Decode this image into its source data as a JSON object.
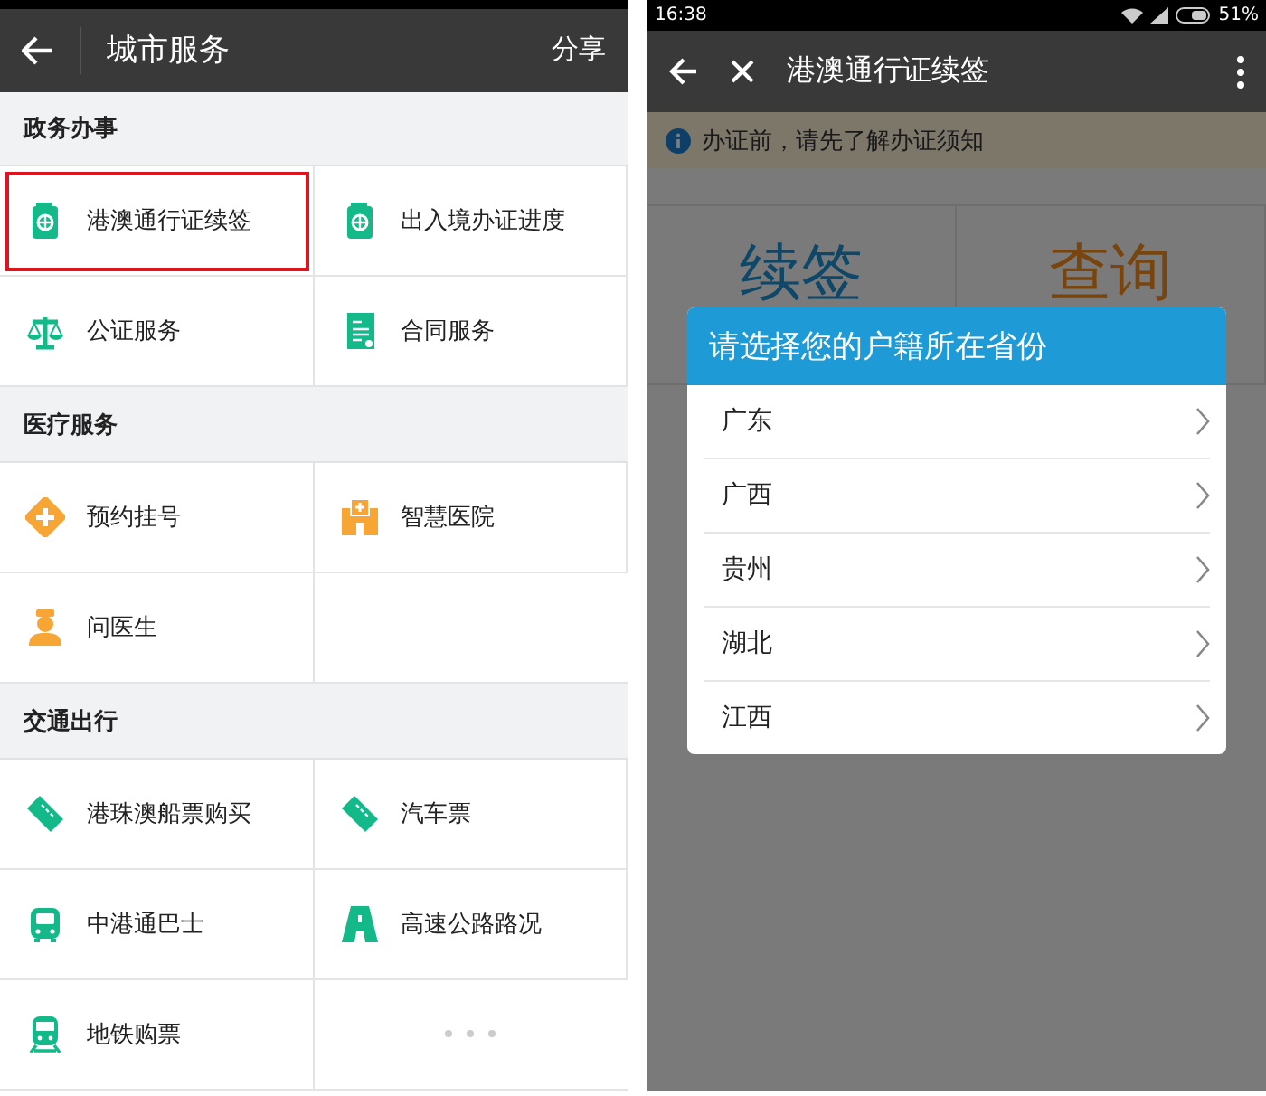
{
  "left_screen": {
    "header": {
      "title": "城市服务",
      "action": "分享"
    },
    "sections": [
      {
        "title": "政务办事",
        "items": [
          {
            "kind": "service",
            "label": "港澳通行证续签",
            "selected": true
          },
          {
            "kind": "service",
            "label": "出入境办证进度",
            "selected": false
          },
          {
            "kind": "service",
            "label": "公证服务",
            "selected": false
          },
          {
            "kind": "service",
            "label": "合同服务",
            "selected": false
          }
        ]
      },
      {
        "title": "医疗服务",
        "items": [
          {
            "kind": "service",
            "label": "预约挂号",
            "selected": false
          },
          {
            "kind": "service",
            "label": "智慧医院",
            "selected": false
          },
          {
            "kind": "service",
            "label": "问医生",
            "selected": false
          },
          {
            "kind": "empty"
          }
        ]
      },
      {
        "title": "交通出行",
        "items": [
          {
            "kind": "service",
            "label": "港珠澳船票购买",
            "selected": false
          },
          {
            "kind": "service",
            "label": "汽车票",
            "selected": false
          },
          {
            "kind": "service",
            "label": "中港通巴士",
            "selected": false
          },
          {
            "kind": "service",
            "label": "高速公路路况",
            "selected": false
          },
          {
            "kind": "service",
            "label": "地铁购票",
            "selected": false
          },
          {
            "kind": "more"
          }
        ]
      }
    ]
  },
  "right_screen": {
    "status_bar": {
      "time": "16:38",
      "battery": "51%"
    },
    "toolbar": {
      "title": "港澳通行证续签"
    },
    "notice": "办证前，请先了解办证须知",
    "actions": [
      {
        "label": "续签"
      },
      {
        "label": "查询"
      }
    ],
    "dialog": {
      "title": "请选择您的户籍所在省份",
      "options": [
        "广东",
        "广西",
        "贵州",
        "湖北",
        "江西"
      ]
    }
  }
}
